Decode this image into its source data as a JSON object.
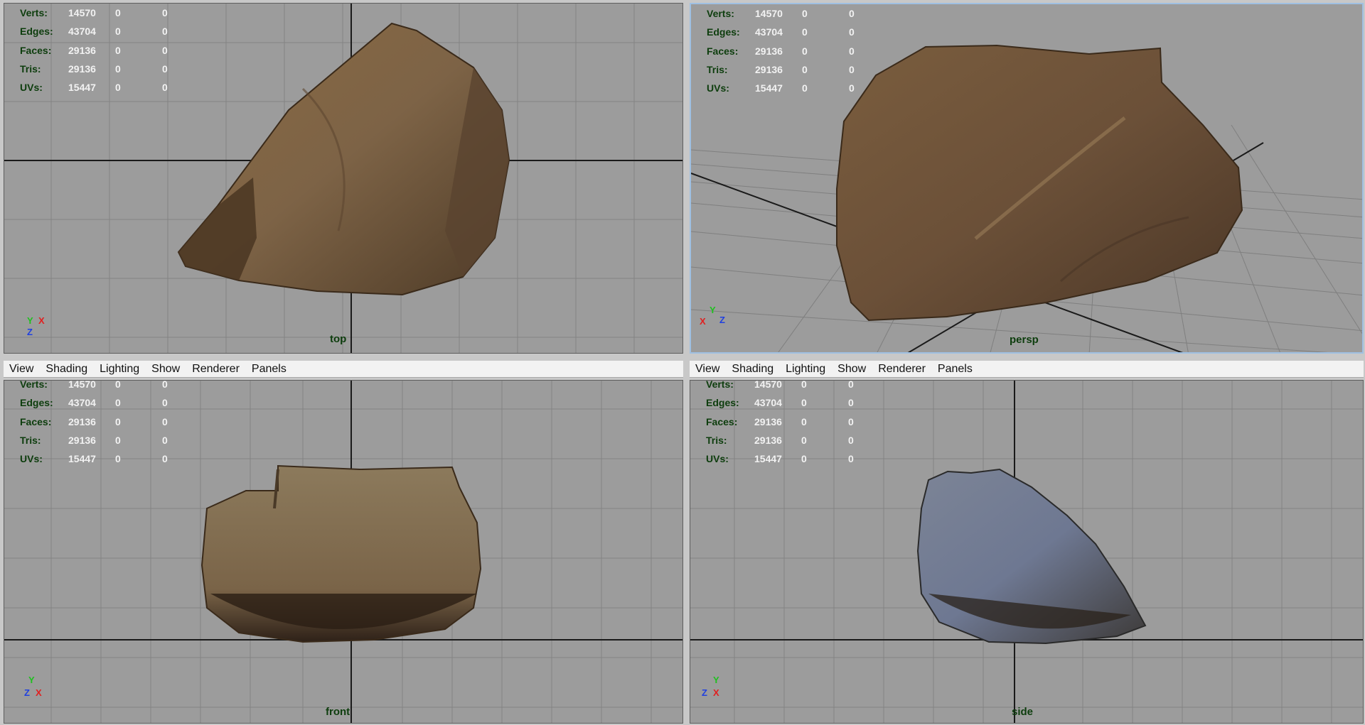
{
  "menu": [
    "View",
    "Shading",
    "Lighting",
    "Show",
    "Renderer",
    "Panels"
  ],
  "hud": {
    "labels": [
      "Verts:",
      "Edges:",
      "Faces:",
      "Tris:",
      "UVs:"
    ],
    "values": [
      "14570",
      "43704",
      "29136",
      "29136",
      "15447"
    ],
    "zeros": [
      "0",
      "0",
      "0",
      "0",
      "0"
    ]
  },
  "viewports": {
    "top": {
      "camera": "top",
      "axis": [
        "Y",
        "X",
        "Z"
      ]
    },
    "persp": {
      "camera": "persp",
      "axis": [
        "X",
        "Y",
        "Z"
      ]
    },
    "front": {
      "camera": "front",
      "axis": [
        "Y",
        "Z",
        "X"
      ]
    },
    "side": {
      "camera": "side",
      "axis": [
        "Y",
        "Z",
        "X"
      ]
    }
  },
  "colors": {
    "viewport_bg": "#9c9c9c",
    "grid": "#838383",
    "axis_line": "#1a1a1a",
    "hud_label": "#0d3d0d",
    "hud_value": "#f2f2f2",
    "active_border": "#9fc0e2",
    "axis_x": "#e02020",
    "axis_y": "#20c020",
    "axis_z": "#2040e0"
  }
}
